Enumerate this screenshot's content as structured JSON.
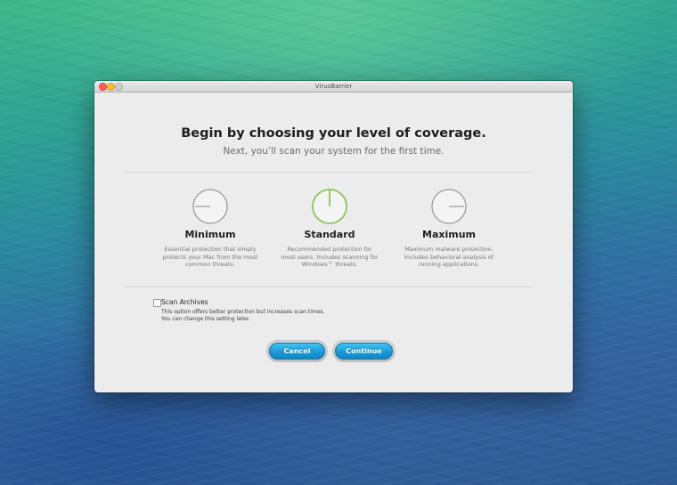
{
  "window": {
    "title": "VirusBarrier"
  },
  "header": {
    "heading": "Begin by choosing your level of coverage.",
    "subheading": "Next, you’ll scan your system for the first time."
  },
  "coverage_options": [
    {
      "title": "Minimum",
      "description": "Essential protection that simply protects your Mac from the most common threats.",
      "selected": false,
      "icon": "dial-minimum-icon"
    },
    {
      "title": "Standard",
      "description": "Recommended protection for most users. Includes scanning for Windows™ threats.",
      "selected": true,
      "icon": "dial-standard-icon"
    },
    {
      "title": "Maximum",
      "description": "Maximum malware protection. Includes behavioral analysis of running applications.",
      "selected": false,
      "icon": "dial-maximum-icon"
    }
  ],
  "scan_archives": {
    "label": "Scan Archives",
    "note_line1": "This option offers better protection but increases scan times.",
    "note_line2": "You can change this setting later.",
    "checked": false
  },
  "buttons": {
    "cancel": "Cancel",
    "continue": "Continue"
  },
  "colors": {
    "accent_blue": "#1a9ad8",
    "selected_green": "#7dc243",
    "dial_gray": "#9a9a9a"
  }
}
